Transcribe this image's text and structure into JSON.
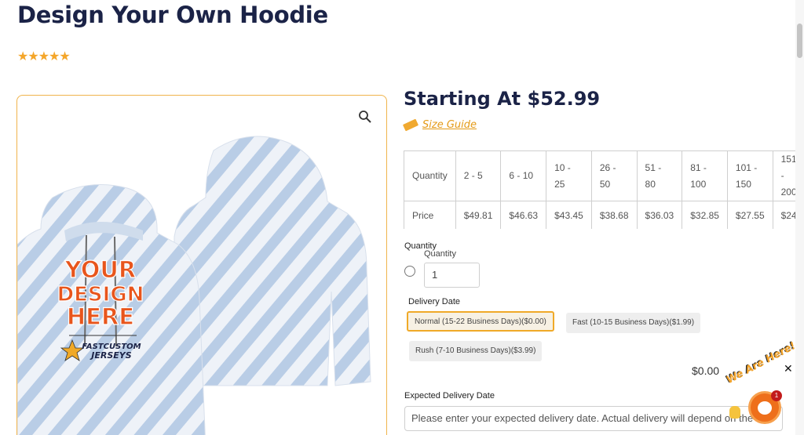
{
  "product": {
    "title": "Design Your Own Hoodie",
    "rating_stars": "★★★★★",
    "price_heading": "Starting At $52.99",
    "size_guide_label": "Size Guide"
  },
  "price_table": {
    "row_quantity_label": "Quantity",
    "row_price_label": "Price",
    "tiers": [
      {
        "qty": "2 - 5",
        "price": "$49.81"
      },
      {
        "qty": "6 - 10",
        "price": "$46.63"
      },
      {
        "qty": "10 - 25",
        "price": "$43.45"
      },
      {
        "qty": "26 - 50",
        "price": "$38.68"
      },
      {
        "qty": "51 - 80",
        "price": "$36.03"
      },
      {
        "qty": "81 - 100",
        "price": "$32.85"
      },
      {
        "qty": "101 - 150",
        "price": "$27.55"
      },
      {
        "qty": "151 - 200",
        "price": "$24"
      }
    ]
  },
  "quantity": {
    "label": "Quantity",
    "sub_label": "Quantity",
    "value": "1"
  },
  "delivery": {
    "label": "Delivery Date",
    "options": [
      {
        "label": "Normal (15-22 Business Days)($0.00)",
        "selected": true
      },
      {
        "label": "Fast (10-15 Business Days)($1.99)",
        "selected": false
      },
      {
        "label": "Rush (7-10 Business Days)($3.99)",
        "selected": false
      }
    ],
    "total": "$0.00"
  },
  "expected_date": {
    "label": "Expected Delivery Date",
    "placeholder": "Please enter your expected delivery date. Actual delivery will depend on the"
  },
  "chat": {
    "tagline": "We Are Here!",
    "unread_count": "1",
    "close_glyph": "✕"
  },
  "artwork": {
    "print_line1": "YOUR",
    "print_line2": "DESIGN",
    "print_line3": "HERE",
    "logo_line1": "FASTCUSTOM",
    "logo_line2": "JERSEYS"
  },
  "colors": {
    "accent": "#f0a928",
    "heading": "#1b2347",
    "hoodie_stripe": "#b9cde6",
    "print_orange": "#e8551c"
  },
  "icons": {
    "zoom": "magnifier-icon",
    "size_guide": "ruler-icon"
  }
}
